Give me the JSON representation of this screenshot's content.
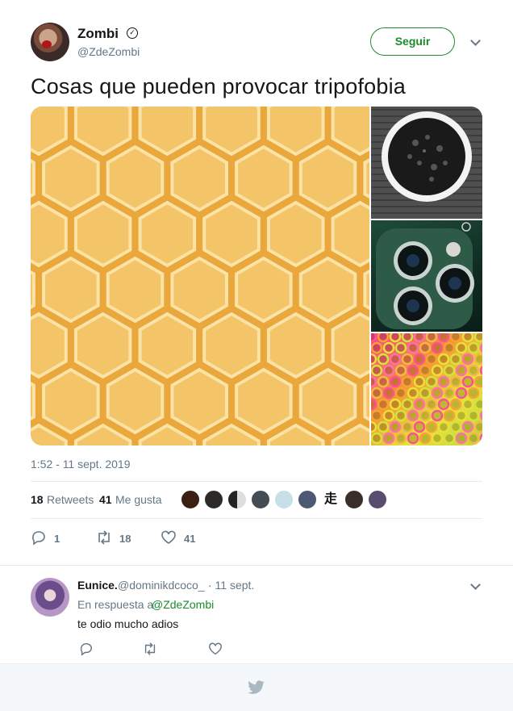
{
  "tweet": {
    "author_name": "Zombi",
    "verified_icon": "verified-badge-icon",
    "author_handle": "@ZdeZombi",
    "follow_label": "Seguir",
    "text": "Cosas que pueden provocar tripofobia",
    "timestamp": "1:52 - 11 sept. 2019",
    "retweets_count": "18",
    "retweets_label": "Retweets",
    "likes_count": "41",
    "likes_label": "Me gusta",
    "actions": {
      "reply_count": "1",
      "retweet_count": "18",
      "like_count": "41"
    }
  },
  "media": [
    {
      "name": "honeycomb-image"
    },
    {
      "name": "coffee-cup-image"
    },
    {
      "name": "phone-cameras-image"
    },
    {
      "name": "straws-image"
    }
  ],
  "likers_avatars": 9,
  "reply": {
    "author_name": "Eunice.",
    "author_handle": "@dominikdcoco_",
    "date": "· 11 sept.",
    "reply_to_prefix": "En respuesta a",
    "reply_to_mention": "@ZdeZombi",
    "text": "te odio mucho adios"
  },
  "icons": {
    "reply": "reply-icon",
    "retweet": "retweet-icon",
    "like": "heart-icon",
    "footer": "twitter-bird-icon"
  },
  "colors": {
    "accent": "#1b8c2c",
    "muted": "#657786",
    "divider": "#e6ecf0",
    "footer_bg": "#f5f8fa"
  }
}
